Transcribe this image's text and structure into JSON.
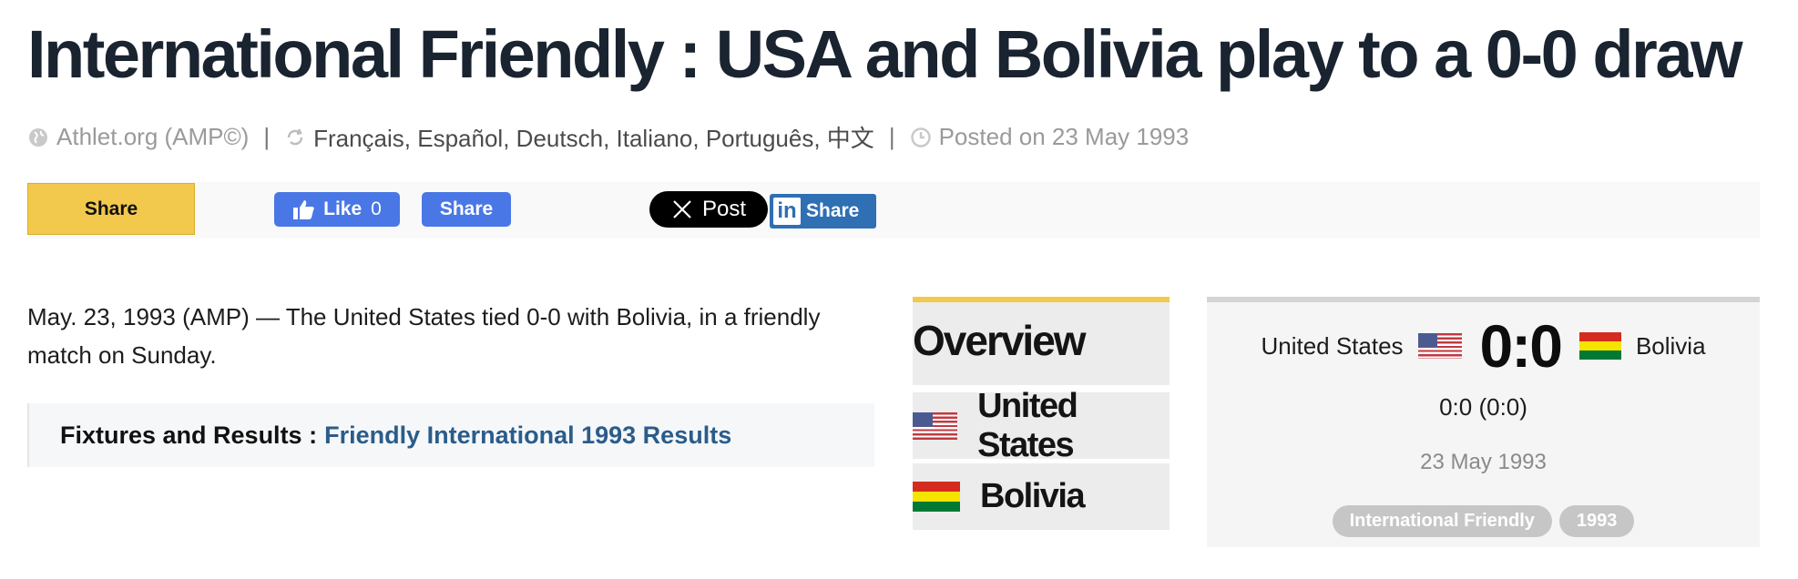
{
  "page": {
    "title": "International Friendly : USA and Bolivia play to a 0-0 draw"
  },
  "meta": {
    "source": "Athlet.org (AMP©)",
    "separator": "|",
    "languages": [
      "Français",
      "Español",
      "Deutsch",
      "Italiano",
      "Português",
      "中文"
    ],
    "posted": "Posted on 23 May 1993",
    "icons": [
      "globe-icon",
      "refresh-icon",
      "clock-icon"
    ]
  },
  "share": {
    "main_label": "Share",
    "fb_like_label": "Like",
    "fb_like_count": "0",
    "fb_share_label": "Share",
    "x_label": "Post",
    "linkedin_label": "Share",
    "colors": {
      "main": "#f2c94c",
      "facebook": "#4a77e6",
      "x": "#000000",
      "linkedin": "#2f6fb3"
    }
  },
  "article": {
    "text": "May. 23, 1993 (AMP) — The United States tied 0-0 with Bolivia, in a friendly match on Sunday.",
    "fixtures_label": "Fixtures and Results :",
    "fixtures_link": "Friendly International 1993 Results"
  },
  "overview": {
    "title": "Overview",
    "teams": [
      {
        "name": "United States",
        "flag": "us-flag-icon"
      },
      {
        "name": "Bolivia",
        "flag": "bolivia-flag-icon"
      }
    ]
  },
  "match": {
    "home": "United States",
    "away": "Bolivia",
    "score": "0:0",
    "halftime": "0:0 (0:0)",
    "date": "23 May 1993",
    "tags": [
      "International Friendly",
      "1993"
    ]
  }
}
